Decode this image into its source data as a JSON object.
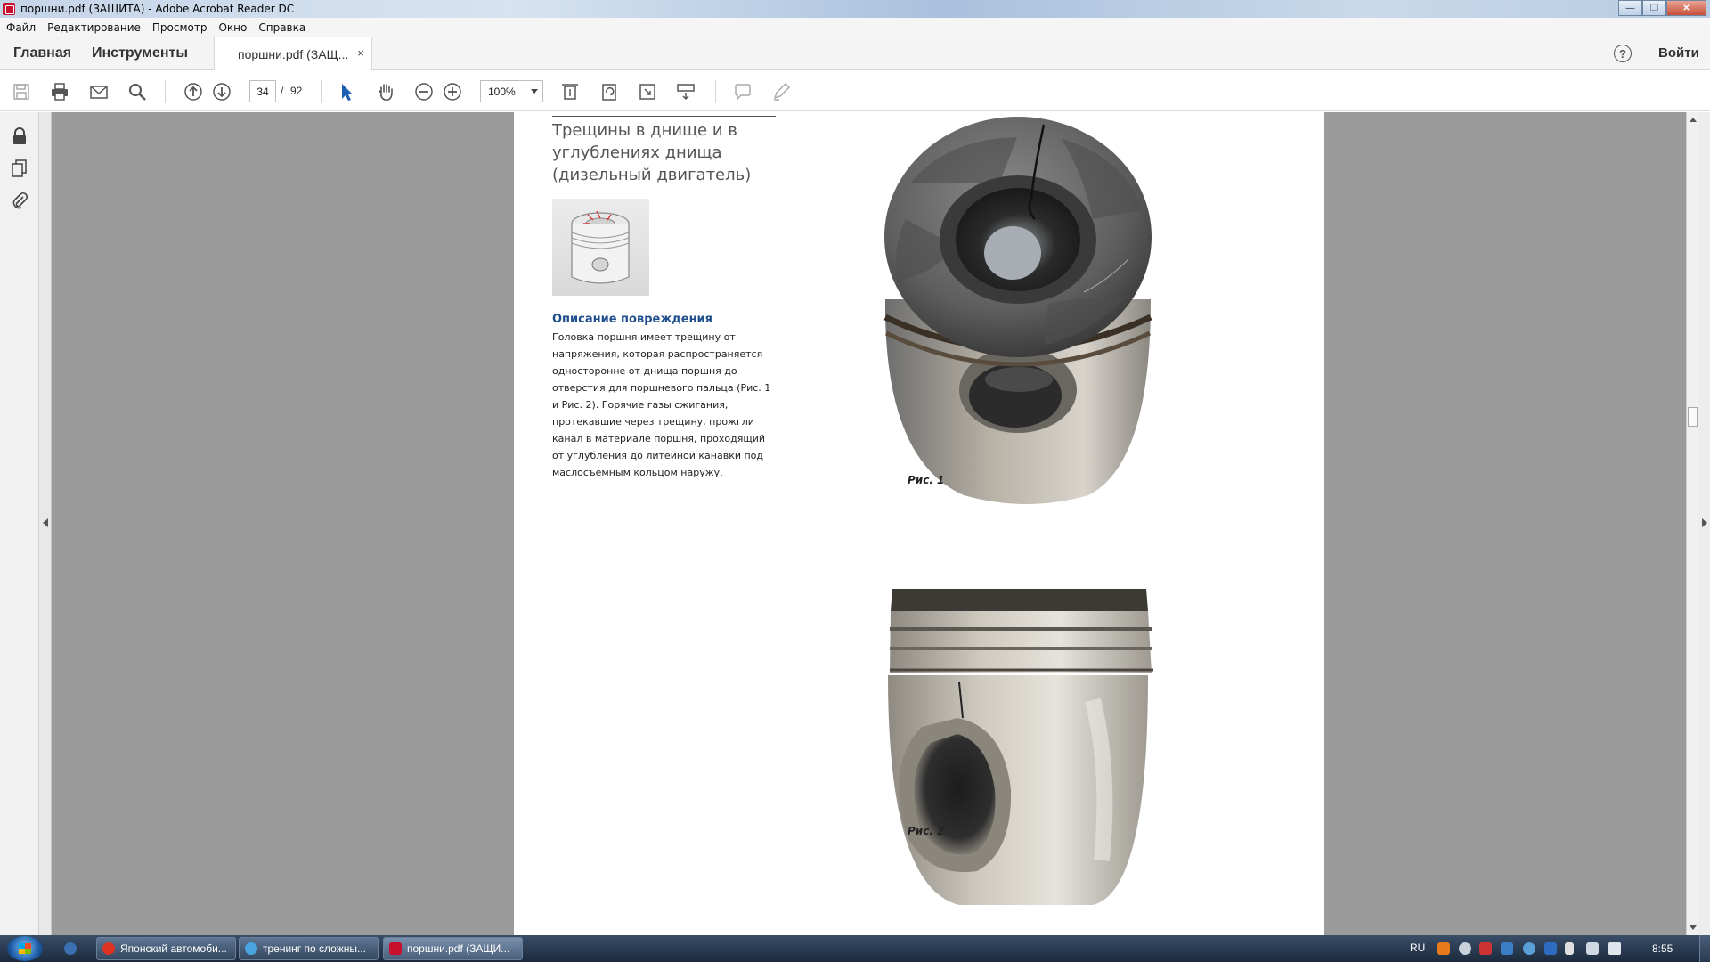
{
  "window": {
    "title": "поршни.pdf (ЗАЩИТА) - Adobe Acrobat Reader DC"
  },
  "menu": [
    "Файл",
    "Редактирование",
    "Просмотр",
    "Окно",
    "Справка"
  ],
  "tabs": {
    "home": "Главная",
    "tools": "Инструменты",
    "doc_tab": "поршни.pdf (ЗАЩ...",
    "close": "×",
    "signin": "Войти",
    "help": "?"
  },
  "toolbar": {
    "page_current": "34",
    "page_sep": "/",
    "page_total": "92",
    "zoom": "100%"
  },
  "document": {
    "heading": "Трещины в днище и в углублениях днища (дизельный двигатель)",
    "subheading": "Описание повреждения",
    "description": "Головка поршня имеет трещину от напряжения, которая распространяется односторонне от днища поршня до отверстия для поршневого пальца (Рис. 1 и Рис. 2). Горячие газы сжигания, протекавшие через трещину, прожгли канал в материале поршня, проходящий от углубления до литейной канавки под маслосъёмным кольцом наружу.",
    "caption1": "Рис. 1",
    "caption2": "Рис. 2"
  },
  "taskbar": {
    "items": [
      "Японский автомоби...",
      "тренинг по сложны...",
      "поршни.pdf (ЗАЩИ..."
    ],
    "lang": "RU",
    "clock": "8:55"
  }
}
